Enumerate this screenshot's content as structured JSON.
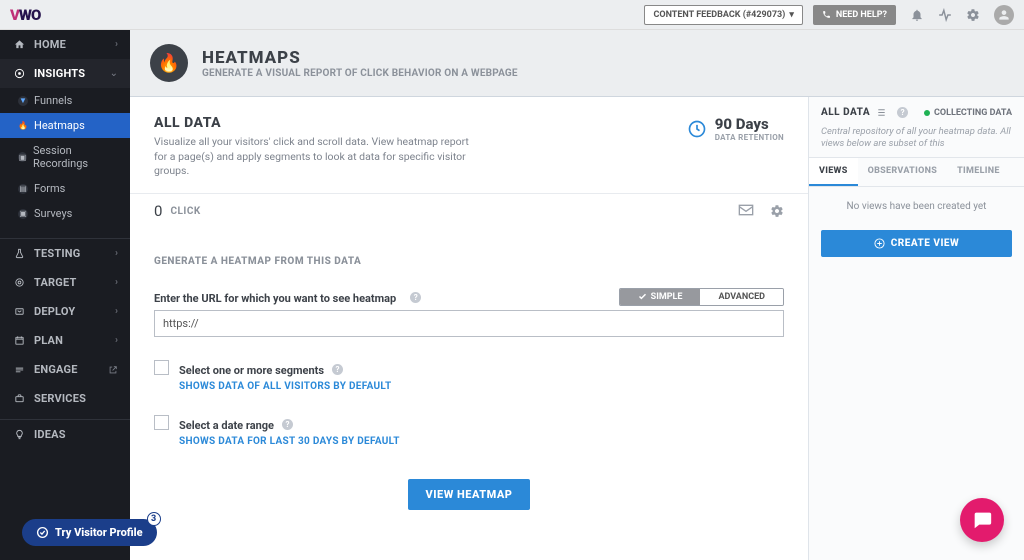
{
  "topbar": {
    "feedback_label": "CONTENT FEEDBACK (#429073)",
    "help_label": "NEED HELP?"
  },
  "logo": {
    "v": "V",
    "wo": "WO"
  },
  "sidebar": {
    "home": "HOME",
    "insights": "INSIGHTS",
    "insights_items": [
      "Funnels",
      "Heatmaps",
      "Session Recordings",
      "Forms",
      "Surveys"
    ],
    "testing": "TESTING",
    "target": "TARGET",
    "deploy": "DEPLOY",
    "plan": "PLAN",
    "engage": "ENGAGE",
    "services": "SERVICES",
    "ideas": "IDEAS"
  },
  "page": {
    "title": "HEATMAPS",
    "subtitle": "GENERATE A VISUAL REPORT OF CLICK BEHAVIOR ON A WEBPAGE"
  },
  "alldata": {
    "title": "ALL DATA",
    "desc": "Visualize all your visitors' click and scroll data. View heatmap report for a page(s) and apply segments to look at data for specific visitor groups.",
    "retention_days": "90 Days",
    "retention_label": "DATA RETENTION"
  },
  "clicks": {
    "count": "0",
    "label": "CLICK"
  },
  "form": {
    "section": "GENERATE A HEATMAP FROM THIS DATA",
    "url_label": "Enter the URL for which you want to see heatmap",
    "mode_simple": "SIMPLE",
    "mode_advanced": "ADVANCED",
    "url_value": "https://",
    "seg_label": "Select one or more segments",
    "seg_hint": "SHOWS DATA OF ALL VISITORS BY DEFAULT",
    "date_label": "Select a date range",
    "date_hint": "SHOWS DATA FOR LAST 30 DAYS BY DEFAULT",
    "submit": "VIEW HEATMAP"
  },
  "rightpanel": {
    "title": "ALL DATA",
    "status": "COLLECTING DATA",
    "desc": "Central repository of all your heatmap data. All views below are subset of this",
    "tabs": [
      "VIEWS",
      "OBSERVATIONS",
      "TIMELINE"
    ],
    "empty": "No views have been created yet",
    "create": "CREATE VIEW"
  },
  "visitor_pill": {
    "label": "Try Visitor Profile",
    "badge": "3"
  }
}
